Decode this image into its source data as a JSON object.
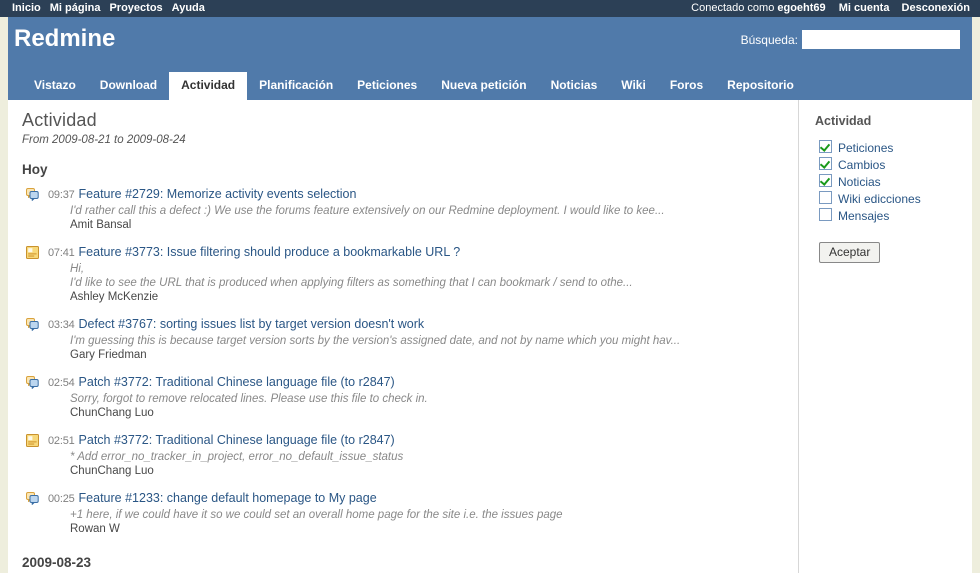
{
  "top_menu": {
    "left_links": [
      {
        "label": "Inicio",
        "name": "top-menu-home"
      },
      {
        "label": "Mi página",
        "name": "top-menu-my-page"
      },
      {
        "label": "Proyectos",
        "name": "top-menu-projects"
      },
      {
        "label": "Ayuda",
        "name": "top-menu-help"
      }
    ],
    "logged_as_prefix": "Conectado como ",
    "username": "egoeht69",
    "right_links": [
      {
        "label": "Mi cuenta",
        "name": "top-menu-my-account"
      },
      {
        "label": "Desconexión",
        "name": "top-menu-logout"
      }
    ]
  },
  "header": {
    "app_title": "Redmine",
    "search_label": "Búsqueda:",
    "search_value": "",
    "search_placeholder": ""
  },
  "main_menu": {
    "items": [
      {
        "label": "Vistazo",
        "selected": false
      },
      {
        "label": "Download",
        "selected": false
      },
      {
        "label": "Actividad",
        "selected": true
      },
      {
        "label": "Planificación",
        "selected": false
      },
      {
        "label": "Peticiones",
        "selected": false
      },
      {
        "label": "Nueva petición",
        "selected": false
      },
      {
        "label": "Noticias",
        "selected": false
      },
      {
        "label": "Wiki",
        "selected": false
      },
      {
        "label": "Foros",
        "selected": false
      },
      {
        "label": "Repositorio",
        "selected": false
      }
    ]
  },
  "content": {
    "page_title": "Actividad",
    "date_range": "From 2009-08-21 to 2009-08-24",
    "days": [
      {
        "heading": "Hoy",
        "entries": [
          {
            "icon": "comment-icon",
            "time": "09:37",
            "title": "Feature #2729: Memorize activity events selection",
            "description": "I'd rather call this a defect :) We use the forums feature extensively on our Redmine deployment. I would like to kee...",
            "author": "Amit Bansal"
          },
          {
            "icon": "note-icon",
            "time": "07:41",
            "title": "Feature #3773: Issue filtering should produce a bookmarkable URL ?",
            "description": "Hi,\nI'd like to see the URL that is produced when applying filters as something that I can bookmark / send to othe...",
            "author": "Ashley McKenzie"
          },
          {
            "icon": "comment-icon",
            "time": "03:34",
            "title": "Defect #3767: sorting issues list by target version doesn't work",
            "description": "I'm guessing this is because target version sorts by the version's assigned date, and not by name which you might hav...",
            "author": "Gary Friedman"
          },
          {
            "icon": "comment-icon",
            "time": "02:54",
            "title": "Patch #3772: Traditional Chinese language file (to r2847)",
            "description": "Sorry, forgot to remove relocated lines. Please use this file to check in.",
            "author": "ChunChang Luo"
          },
          {
            "icon": "note-icon",
            "time": "02:51",
            "title": "Patch #3772: Traditional Chinese language file (to r2847)",
            "description": "* Add error_no_tracker_in_project, error_no_default_issue_status",
            "author": "ChunChang Luo"
          },
          {
            "icon": "comment-icon",
            "time": "00:25",
            "title": "Feature #1233: change default homepage to My page",
            "description": "+1 here, if we could have it so we could set an overall home page for the site i.e. the issues page",
            "author": "Rowan W"
          }
        ]
      },
      {
        "heading": "2009-08-23",
        "entries": []
      }
    ]
  },
  "sidebar": {
    "title": "Actividad",
    "filters": [
      {
        "label": "Peticiones",
        "checked": true,
        "name": "filter-peticiones"
      },
      {
        "label": "Cambios",
        "checked": true,
        "name": "filter-cambios"
      },
      {
        "label": "Noticias",
        "checked": true,
        "name": "filter-noticias"
      },
      {
        "label": "Wiki edicciones",
        "checked": false,
        "name": "filter-wiki"
      },
      {
        "label": "Mensajes",
        "checked": false,
        "name": "filter-mensajes"
      }
    ],
    "apply_label": "Aceptar"
  },
  "colors": {
    "top_bar": "#2C4056",
    "header_blue": "#507AAA",
    "page_bg": "#EEEEDD",
    "link_blue": "#2A5685",
    "check_green": "#1A9A1A"
  }
}
